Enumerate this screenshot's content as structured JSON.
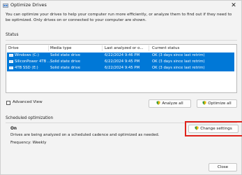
{
  "window": {
    "title": "Optimize Drives",
    "close_glyph": "✕"
  },
  "description": "You can optimize your drives to help your computer run more efficiently, or analyze them to find out if they need to be optimized. Only drives on or connected to your computer are shown.",
  "status": {
    "label": "Status",
    "columns": [
      "Drive",
      "Media type",
      "Last analyzed or o...",
      "Current status"
    ],
    "rows": [
      {
        "drive": "Windows (C:)",
        "media": "Solid state drive",
        "last": "6/22/2024 9:46 PM",
        "status": "OK (3 days since last retrim)"
      },
      {
        "drive": "SiliconPower 4TB ...",
        "media": "Solid state drive",
        "last": "6/22/2024 9:45 PM",
        "status": "OK (3 days since last retrim)"
      },
      {
        "drive": "4TB SSD (E:)",
        "media": "Solid state drive",
        "last": "6/22/2024 9:45 PM",
        "status": "OK (3 days since last retrim)"
      }
    ],
    "advanced_view": "Advanced View",
    "analyze_all": "Analyze all",
    "optimize_all": "Optimize all"
  },
  "scheduled": {
    "label": "Scheduled optimization",
    "state": "On",
    "description": "Drives are being analyzed on a scheduled cadence and optimized as needed.",
    "frequency": "Frequency: Weekly",
    "change_settings": "Change settings"
  },
  "footer": {
    "close": "Close"
  },
  "colors": {
    "selection": "#0078d7",
    "highlight_box": "#e0231c"
  }
}
